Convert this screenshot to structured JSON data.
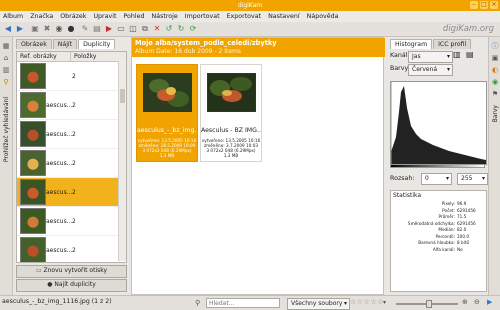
{
  "window": {
    "title": "digiKam"
  },
  "menu": [
    "Album",
    "Značka",
    "Obrázek",
    "Upravit",
    "Pohled",
    "Nástroje",
    "Importovat",
    "Exportovat",
    "Nastavení",
    "Nápověda"
  ],
  "brand": "digiKam.org",
  "left_tabs": [
    "Obrázek",
    "Nájít",
    "Duplicity"
  ],
  "left_strip_label": "Prohlížeč vyhledávání",
  "album_table": {
    "headers": [
      "Ref. obrázky",
      "Položky"
    ],
    "rows": [
      {
        "label": "",
        "count": "2"
      },
      {
        "label": "aescus...",
        "count": "2"
      },
      {
        "label": "aescus...",
        "count": "2"
      },
      {
        "label": "aescus...",
        "count": "2"
      },
      {
        "label": "aescus...",
        "count": "2"
      },
      {
        "label": "aescus...",
        "count": "2"
      },
      {
        "label": "aescus...",
        "count": "2"
      },
      {
        "label": "aescus...",
        "count": "2"
      }
    ],
    "selected_index": 4
  },
  "buttons": {
    "recreate": "Znovu vytvořit otisky",
    "find": "Najít duplicity"
  },
  "album_header": {
    "path": "Moje alba/system_podle_celedi/zbytky",
    "date": "Album Date: 16 dub 2009 - 2 Items"
  },
  "cards": [
    {
      "name": "aesculus_-_bz_img...",
      "meta": [
        "vytvořeno: 13.5.2005 10:16",
        "změněno: 28.5.2009 19:09",
        "3 072x2 048 (6.29Mpx)",
        "1,3 MB"
      ]
    },
    {
      "name": "Aesculus - BZ IMG...",
      "meta": [
        "vytvořeno: 13.5.2005 10:16",
        "změněno: 3.7.2009 10:03",
        "3 072x2 048 (6.29Mpx)",
        "1,3 MB"
      ]
    }
  ],
  "right_tabs": [
    "Histogram",
    "ICC profil"
  ],
  "histogram": {
    "channel_label": "Kanál:",
    "channel_value": "Jas",
    "colors_label": "Barvy:",
    "colors_value": "Červená",
    "range_label": "Rozsah:",
    "range_min": "0",
    "range_max": "255"
  },
  "statistics": {
    "title": "Statistika",
    "rows": [
      {
        "label": "Pixely:",
        "value": "96.9"
      },
      {
        "label": "Počet:",
        "value": "6291456"
      },
      {
        "label": "Průměr:",
        "value": "71.5"
      },
      {
        "label": "Směrodatná odchylka:",
        "value": "6291456"
      },
      {
        "label": "Medián:",
        "value": "82.0"
      },
      {
        "label": "Percentil:",
        "value": "100.0"
      },
      {
        "label": "Barevná hloubka:",
        "value": "8 bitů"
      },
      {
        "label": "Alfa kanál:",
        "value": "Ne"
      }
    ]
  },
  "right_strip_labels": [
    "Vlastnosti",
    "Metadata",
    "Barvy"
  ],
  "status": {
    "file": "aesculus_-_bz_img_1116.jpg (1 z 2)",
    "search_placeholder": "Hledat...",
    "filter": "Všechny soubory"
  },
  "colors": {
    "accent": "#f1a400",
    "selected": "#f1b21b"
  }
}
